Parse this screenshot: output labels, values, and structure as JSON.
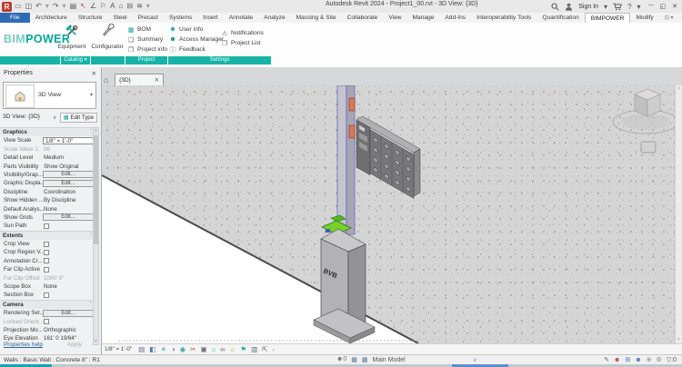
{
  "window": {
    "title": "Autodesk Revit 2024 - Project1_00.rvt - 3D View: {3D}",
    "sign_in": "Sign In",
    "logo_letter": "R",
    "caret": "▾",
    "controls": [
      {
        "n": "minimize-button",
        "g": "─",
        "c": "#444"
      },
      {
        "n": "restore-button",
        "g": "◱",
        "c": "#444"
      },
      {
        "n": "close-button",
        "g": "✕",
        "c": "#444"
      }
    ],
    "help_glyph": "?"
  },
  "qat": [
    {
      "n": "open-icon",
      "g": "▭",
      "c": "#555"
    },
    {
      "n": "save-icon",
      "g": "◫",
      "c": "#555"
    },
    {
      "n": "undo-icon",
      "g": "↶",
      "c": "#555"
    },
    {
      "n": "undo-dropdown-icon",
      "g": "▾",
      "c": "#999"
    },
    {
      "n": "redo-icon",
      "g": "↷",
      "c": "#555"
    },
    {
      "n": "redo-dropdown-icon",
      "g": "▾",
      "c": "#999"
    },
    {
      "n": "print-icon",
      "g": "▤",
      "c": "#555"
    },
    {
      "n": "modify-arrow-icon",
      "g": "↖",
      "c": "#b0483a"
    },
    {
      "n": "measure-icon",
      "g": "∠",
      "c": "#555"
    },
    {
      "n": "tag-icon",
      "g": "⚐",
      "c": "#555"
    },
    {
      "n": "text-icon",
      "g": "A",
      "c": "#555"
    },
    {
      "n": "default-3d-view-icon",
      "g": "⌂",
      "c": "#555"
    },
    {
      "n": "section-icon",
      "g": "⊟",
      "c": "#555"
    },
    {
      "n": "thin-lines-icon",
      "g": "≋",
      "c": "#555"
    },
    {
      "n": "qat-customize-icon",
      "g": "▾",
      "c": "#999"
    }
  ],
  "ribbon_tabs": [
    {
      "label": "File",
      "type": "file"
    },
    {
      "label": "Architecture",
      "type": "normal"
    },
    {
      "label": "Structure",
      "type": "normal"
    },
    {
      "label": "Steel",
      "type": "normal"
    },
    {
      "label": "Precast",
      "type": "normal"
    },
    {
      "label": "Systems",
      "type": "normal"
    },
    {
      "label": "Insert",
      "type": "normal"
    },
    {
      "label": "Annotate",
      "type": "normal"
    },
    {
      "label": "Analyze",
      "type": "normal"
    },
    {
      "label": "Massing & Site",
      "type": "normal"
    },
    {
      "label": "Collaborate",
      "type": "normal"
    },
    {
      "label": "View",
      "type": "normal"
    },
    {
      "label": "Manage",
      "type": "normal"
    },
    {
      "label": "Add-Ins",
      "type": "normal"
    },
    {
      "label": "Interoperability Tools",
      "type": "normal"
    },
    {
      "label": "Quantification",
      "type": "normal"
    },
    {
      "label": "BIMPOWER",
      "type": "active"
    },
    {
      "label": "Modify",
      "type": "normal"
    },
    {
      "label": "⊡ ▾",
      "type": "icon"
    }
  ],
  "bimpower": {
    "brand_bim": "BIM",
    "brand_power": "POWER",
    "equipment_label": "Equipment",
    "configurator_label": "Configurator",
    "project_buttons": [
      {
        "label": "BOM",
        "g": "▦",
        "c": "#1aa79b"
      },
      {
        "label": "Summary",
        "g": "❑",
        "c": "#666"
      },
      {
        "label": "Project info",
        "g": "❒",
        "c": "#666"
      }
    ],
    "settings_buttons": [
      {
        "label": "User info",
        "g": "☻",
        "c": "#1aa79b"
      },
      {
        "label": "Access Manager",
        "g": "☻",
        "c": "#0d8f84"
      },
      {
        "label": "Feedback",
        "g": "ⓘ",
        "c": "#666"
      }
    ],
    "notif_buttons": [
      {
        "label": "Notifications",
        "g": "⚠",
        "c": "#555"
      },
      {
        "label": "Project List",
        "g": "❒",
        "c": "#666"
      }
    ],
    "panels": [
      "",
      "Catalog ▾",
      "",
      "Project",
      "Settings"
    ]
  },
  "properties": {
    "title": "Properties",
    "close_glyph": "✕",
    "type_name": "3D View",
    "type_dropdown_glyph": "▾",
    "view_selector": "3D View: {3D}",
    "view_dropdown_glyph": "∨",
    "edit_type_label": "Edit Type",
    "edit_type_glyph": "▦",
    "rows": [
      {
        "t": "section",
        "l": "Graphics"
      },
      {
        "t": "input",
        "l": "View Scale",
        "v": "1/8\" = 1'-0\""
      },
      {
        "t": "text",
        "l": "Scale Value    1:",
        "v": "96",
        "gray": true
      },
      {
        "t": "text",
        "l": "Detail Level",
        "v": "Medium"
      },
      {
        "t": "text",
        "l": "Parts Visibility",
        "v": "Show Original"
      },
      {
        "t": "button",
        "l": "Visibility/Grap...",
        "v": "Edit..."
      },
      {
        "t": "button",
        "l": "Graphic Displa...",
        "v": "Edit..."
      },
      {
        "t": "text",
        "l": "Discipline",
        "v": "Coordination"
      },
      {
        "t": "text",
        "l": "Show Hidden ...",
        "v": "By Discipline"
      },
      {
        "t": "text",
        "l": "Default Analys...",
        "v": "None"
      },
      {
        "t": "button",
        "l": "Show Grids",
        "v": "Edit..."
      },
      {
        "t": "check",
        "l": "Sun Path"
      },
      {
        "t": "section",
        "l": "Extents"
      },
      {
        "t": "check",
        "l": "Crop View"
      },
      {
        "t": "check",
        "l": "Crop Region V..."
      },
      {
        "t": "check",
        "l": "Annotation Cr..."
      },
      {
        "t": "check",
        "l": "Far Clip Active"
      },
      {
        "t": "text",
        "l": "Far Clip Offset",
        "v": "1000'  0\"",
        "gray": true
      },
      {
        "t": "text",
        "l": "Scope Box",
        "v": "None"
      },
      {
        "t": "check",
        "l": "Section Box"
      },
      {
        "t": "section",
        "l": "Camera"
      },
      {
        "t": "button",
        "l": "Rendering Set...",
        "v": "Edit..."
      },
      {
        "t": "check",
        "l": "Locked Orient...",
        "gray": true
      },
      {
        "t": "text",
        "l": "Projection Mo...",
        "v": "Orthographic"
      },
      {
        "t": "text",
        "l": "Eye Elevation",
        "v": "161'  0 19/64\""
      }
    ],
    "help": "Properties help",
    "apply": "Apply"
  },
  "viewtab": {
    "home_glyph": "⌂",
    "label": "{3D}",
    "close_glyph": "✕"
  },
  "viewport": {
    "cabinet_label": "BVB"
  },
  "view_control": {
    "scale": "1/8\" = 1'-0\"",
    "icons": [
      {
        "n": "detail-level-icon",
        "g": "▤",
        "c": "#667"
      },
      {
        "n": "visual-style-icon",
        "g": "◧",
        "c": "#4a78b8"
      },
      {
        "n": "sun-path-icon",
        "g": "☀",
        "c": "#2fa99a"
      },
      {
        "n": "shadows-icon",
        "g": "◑",
        "c": "#778"
      },
      {
        "n": "rendering-dialog-icon",
        "g": "◉",
        "c": "#2fa99a"
      },
      {
        "n": "crop-view-icon",
        "g": "✂",
        "c": "#b05048"
      },
      {
        "n": "crop-region-icon",
        "g": "▣",
        "c": "#667"
      },
      {
        "n": "unlocked-view-icon",
        "g": "⌂",
        "c": "#2fa99a"
      },
      {
        "n": "hide-isolate-icon",
        "g": "∞",
        "c": "#555"
      },
      {
        "n": "reveal-hidden-icon",
        "g": "☼",
        "c": "#b89b2a"
      },
      {
        "n": "temp-view-properties-icon",
        "g": "⚑",
        "c": "#2fa99a"
      },
      {
        "n": "analytical-model-icon",
        "g": "▥",
        "c": "#667"
      },
      {
        "n": "reveal-constraints-icon",
        "g": "⇱",
        "c": "#667"
      },
      {
        "n": "vcb-expand-icon",
        "g": "‹",
        "c": "#999"
      }
    ]
  },
  "status": {
    "selection": "Walls : Basic Wall : Concrete 8\" : R1",
    "left_icons": [
      {
        "n": "editable-only-icon",
        "g": "☻0",
        "c": "#777"
      },
      {
        "n": "worksets-icon",
        "g": "▦",
        "c": "#5a7a9a"
      },
      {
        "n": "design-options-icon",
        "g": "▦",
        "c": "#5a7a9a"
      }
    ],
    "main_model": "Main Model",
    "dropdown_glyph": "∨",
    "right_icons": [
      {
        "n": "editable-toggle-icon",
        "g": "✎",
        "c": "#667"
      },
      {
        "n": "exclude-options-icon",
        "g": "☻",
        "c": "#bf4b42"
      },
      {
        "n": "press-drag-icon",
        "g": "⊞",
        "c": "#4a78b8"
      },
      {
        "n": "select-underlay-icon",
        "g": "☻",
        "c": "#4a78b8"
      },
      {
        "n": "select-pinned-icon",
        "g": "⊕",
        "c": "#888"
      },
      {
        "n": "select-by-face-icon",
        "g": "⚙",
        "c": "#888"
      },
      {
        "n": "filter-icon",
        "g": "▽:0",
        "c": "#555"
      }
    ]
  }
}
